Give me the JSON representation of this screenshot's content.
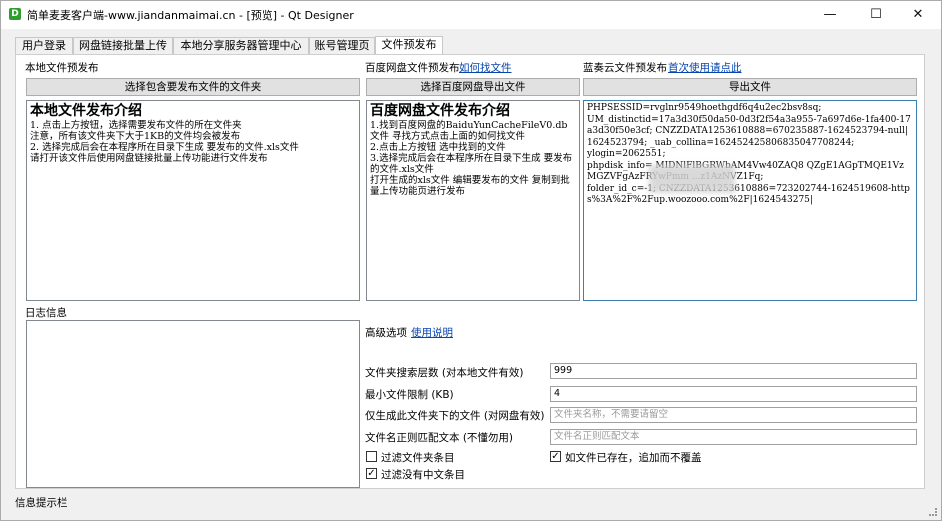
{
  "window": {
    "title": "简单麦麦客户端-www.jiandanmaimai.cn - [预览] - Qt Designer",
    "icon_text": "D",
    "minimize": "—",
    "maximize": "☐",
    "close": "✕"
  },
  "tabs": [
    "用户登录",
    "网盘链接批量上传",
    "本地分享服务器管理中心",
    "账号管理页",
    "文件预发布"
  ],
  "active_tab": 4,
  "local": {
    "label": "本地文件预发布",
    "button": "选择包含要发布文件的文件夹",
    "heading": "本地文件发布介绍",
    "lines": [
      "1. 点击上方按钮，选择需要发布文件的所在文件夹",
      "注意，所有该文件夹下大于1KB的文件均会被发布",
      "2. 选择完成后会在本程序所在目录下生成 要发布的文件.xls文件",
      "请打开该文件后使用网盘链接批量上传功能进行文件发布"
    ]
  },
  "baidu": {
    "label": "百度网盘文件预发布",
    "link": "如何找文件",
    "button": "选择百度网盘导出文件",
    "heading": "百度网盘文件发布介绍",
    "lines": [
      "1.找到百度网盘的BaiduYunCacheFileV0.db文件 寻找方式点击上面的如何找文件",
      "2.点击上方按钮 选中找到的文件",
      "3.选择完成后会在本程序所在目录下生成 要发布的文件.xls文件",
      "打开生成的xls文件 编辑要发布的文件 复制到批量上传功能页进行发布"
    ]
  },
  "lanzou": {
    "label": "蓝奏云文件预发布",
    "link": "首次使用请点此",
    "button": "导出文件",
    "lines": [
      "PHPSESSID=rvglnr9549hoethgdf6q4u2ec2bsv8sq;",
      "UM_distinctid=17a3d30f50da50-0d3f2f54a3a955-7a697d6e-1fa400-17a3d30f50e3cf; CNZZDATA1253610888=670235887-1624523794-null|1624523794; _uab_collina=162452425806835047708244;",
      "ylogin=2062551;",
      "phpdisk_info=                                       MIDNlFlBGRWbAM4Vw40ZAQ8                             QZgE1AGpTMQE1VzMGZVFgAzFRYwPmm                      ...z1AzNVZ1Fq;",
      "folder_id_c=-1; CNZZDATA1253610886=723202744-1624519608-https%3A%2F%2Fup.woozooo.com%2F|1624543275|"
    ]
  },
  "log": {
    "label": "日志信息"
  },
  "advanced": {
    "label": "高级选项",
    "link": "使用说明",
    "search_depth_label": "文件夹搜索层数 (对本地文件有效)",
    "search_depth_value": "999",
    "min_size_label": "最小文件限制 (KB)",
    "min_size_value": "4",
    "only_folder_label": "仅生成此文件夹下的文件 (对网盘有效)",
    "only_folder_placeholder": "文件夹名称，不需要请留空",
    "regex_label": "文件名正则匹配文本 (不懂勿用)",
    "regex_placeholder": "文件名正则匹配文本",
    "filter_folder_label": "过滤文件夹条目",
    "filter_folder_checked": false,
    "append_label": "如文件已存在，追加而不覆盖",
    "append_checked": true,
    "filter_no_cn_label": "过滤没有中文条目",
    "filter_no_cn_checked": true
  },
  "status_bar": "信息提示栏"
}
